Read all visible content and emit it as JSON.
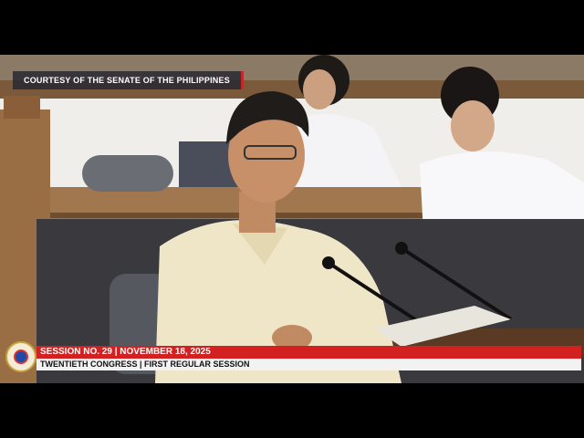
{
  "overlay": {
    "courtesy": "COURTESY OF THE SENATE OF THE PHILIPPINES",
    "session_line": "SESSION NO. 29 | NOVEMBER 18, 2025",
    "congress_line": "TWENTIETH CONGRESS | FIRST REGULAR SESSION"
  },
  "colors": {
    "banner_red": "#d32020",
    "banner_white": "#f2f2f2",
    "courtesy_bg": "#28283a"
  },
  "icons": {
    "seal": "senate-seal-icon"
  }
}
